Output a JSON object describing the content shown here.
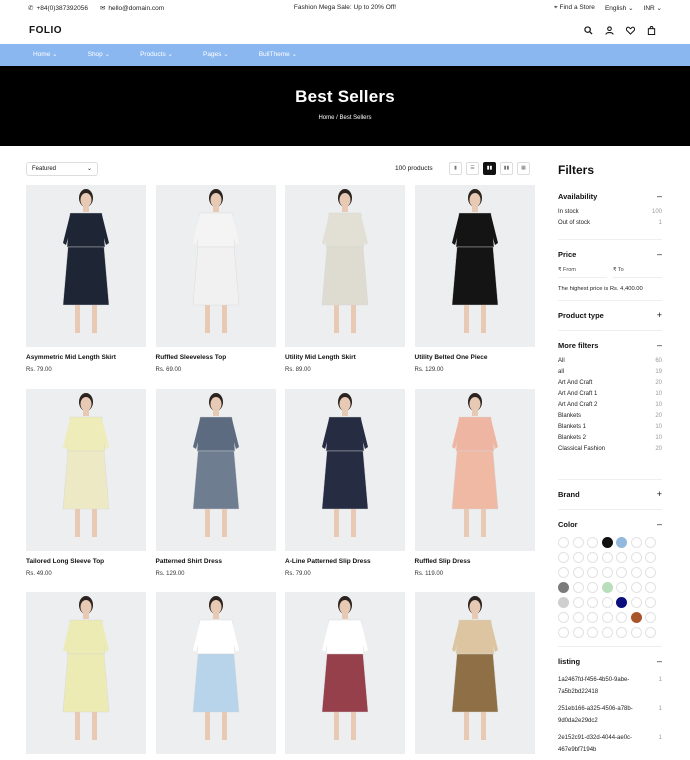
{
  "topbar": {
    "phone": "+84(0)387392056",
    "email": "hello@domain.com",
    "promo": "Fashion Mega Sale: Up to 20% Off!",
    "store": "Find a Store",
    "language": "English",
    "currency": "INR"
  },
  "header": {
    "logo": "FOLIO"
  },
  "nav": [
    "Home",
    "Shop",
    "Products",
    "Pages",
    "BullTheme"
  ],
  "hero": {
    "title": "Best Sellers",
    "crumb_home": "Home",
    "crumb_sep": "/",
    "crumb_current": "Best Sellers"
  },
  "toolbar": {
    "sort": "Featured",
    "count": "100 products"
  },
  "products": [
    {
      "name": "Asymmetric Mid Length Skirt",
      "price": "Rs. 79.00",
      "top": "#1e2636",
      "bottom": "#1e2636"
    },
    {
      "name": "Ruffled Sleeveless Top",
      "price": "Rs. 69.00",
      "top": "#f4f4f4",
      "bottom": "#f1f1f1"
    },
    {
      "name": "Utility Mid Length Skirt",
      "price": "Rs. 89.00",
      "top": "#e2e0d4",
      "bottom": "#dedbd0"
    },
    {
      "name": "Utility Belted One Piece",
      "price": "Rs. 129.00",
      "top": "#141414",
      "bottom": "#141414"
    },
    {
      "name": "Tailored Long Sleeve Top",
      "price": "Rs. 49.00",
      "top": "#eeecb8",
      "bottom": "#ece9c4"
    },
    {
      "name": "Patterned Shirt Dress",
      "price": "Rs. 129.00",
      "top": "#5c6b80",
      "bottom": "#6f7d90"
    },
    {
      "name": "A-Line Patterned Slip Dress",
      "price": "Rs. 79.00",
      "top": "#262c42",
      "bottom": "#262c42"
    },
    {
      "name": "Ruffled Slip Dress",
      "price": "Rs. 119.00",
      "top": "#eeb6a2",
      "bottom": "#efb9a4"
    },
    {
      "name": "",
      "price": "",
      "top": "#ecebb4",
      "bottom": "#ecebb4"
    },
    {
      "name": "",
      "price": "",
      "top": "#ffffff",
      "bottom": "#b7d4ea"
    },
    {
      "name": "",
      "price": "",
      "top": "#ffffff",
      "bottom": "#96404c"
    },
    {
      "name": "",
      "price": "",
      "top": "#dcc5a0",
      "bottom": "#8f7046"
    }
  ],
  "filters": {
    "title": "Filters",
    "availability": {
      "label": "Availability",
      "items": [
        {
          "label": "In stock",
          "count": "100"
        },
        {
          "label": "Out of stock",
          "count": "1"
        }
      ]
    },
    "price": {
      "label": "Price",
      "from": "₹  From",
      "to": "₹  To",
      "highest": "The highest price is Rs. 4,400.00"
    },
    "product_type": {
      "label": "Product type"
    },
    "more": {
      "label": "More filters",
      "items": [
        {
          "label": "All",
          "count": "60"
        },
        {
          "label": "all",
          "count": "19"
        },
        {
          "label": "Art And Craft",
          "count": "20"
        },
        {
          "label": "Art And Craft 1",
          "count": "10"
        },
        {
          "label": "Art And Craft 2",
          "count": "10"
        },
        {
          "label": "Blankets",
          "count": "20"
        },
        {
          "label": "Blankets 1",
          "count": "10"
        },
        {
          "label": "Blankets 2",
          "count": "10"
        },
        {
          "label": "Classical Fashion",
          "count": "20"
        }
      ]
    },
    "brand": {
      "label": "Brand"
    },
    "color": {
      "label": "Color",
      "swatches": [
        "#ffffff",
        "#ffffff",
        "#ffffff",
        "#111111",
        "#92b9dd",
        "#ffffff",
        "#ffffff",
        "#ffffff",
        "#ffffff",
        "#ffffff",
        "#ffffff",
        "#ffffff",
        "#ffffff",
        "#ffffff",
        "#ffffff",
        "#ffffff",
        "#ffffff",
        "#ffffff",
        "#ffffff",
        "#ffffff",
        "#ffffff",
        "#7a7a7a",
        "#ffffff",
        "#ffffff",
        "#b9dfba",
        "#ffffff",
        "#ffffff",
        "#ffffff",
        "#cfcfcf",
        "#ffffff",
        "#ffffff",
        "#ffffff",
        "#0b0e7d",
        "#ffffff",
        "#ffffff",
        "#ffffff",
        "#ffffff",
        "#ffffff",
        "#ffffff",
        "#ffffff",
        "#a8552c",
        "#ffffff",
        "#ffffff",
        "#ffffff",
        "#ffffff",
        "#ffffff",
        "#ffffff",
        "#ffffff",
        "#ffffff"
      ]
    },
    "listing": {
      "label": "listing",
      "items": [
        {
          "label": "1a2467fd-f456-4b50-9abe-7a5b2bd22418",
          "count": "1"
        },
        {
          "label": "251eb166-a325-4506-a78b-9d0da2e29dc2",
          "count": "1"
        },
        {
          "label": "2e152c91-d32d-4044-ae0c-467e9bf7194b",
          "count": "1"
        }
      ]
    }
  }
}
